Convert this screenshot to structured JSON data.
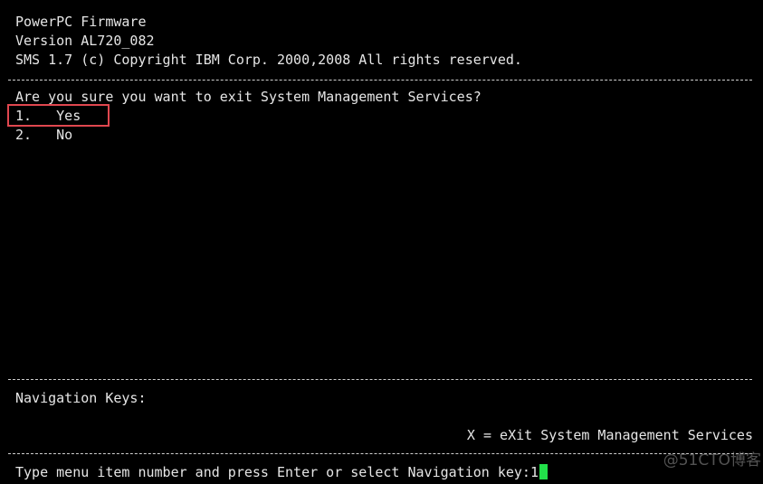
{
  "header": {
    "line1": "PowerPC Firmware",
    "line2": "Version AL720_082",
    "line3": "SMS 1.7 (c) Copyright IBM Corp. 2000,2008 All rights reserved."
  },
  "prompt": {
    "question": "Are you sure you want to exit System Management Services?"
  },
  "menu": {
    "items": [
      {
        "number": "1.",
        "label": "Yes"
      },
      {
        "number": "2.",
        "label": "No"
      }
    ]
  },
  "navigation": {
    "heading": "Navigation Keys:",
    "exit_key": "X = eXit System Management Services"
  },
  "input": {
    "prompt": "Type menu item number and press Enter or select Navigation key:",
    "value": "1"
  },
  "watermark": {
    "text": "@51CTO博客"
  },
  "colors": {
    "background": "#000000",
    "text": "#e6e6e6",
    "highlight": "#e0474f",
    "cursor": "#22e04a"
  }
}
